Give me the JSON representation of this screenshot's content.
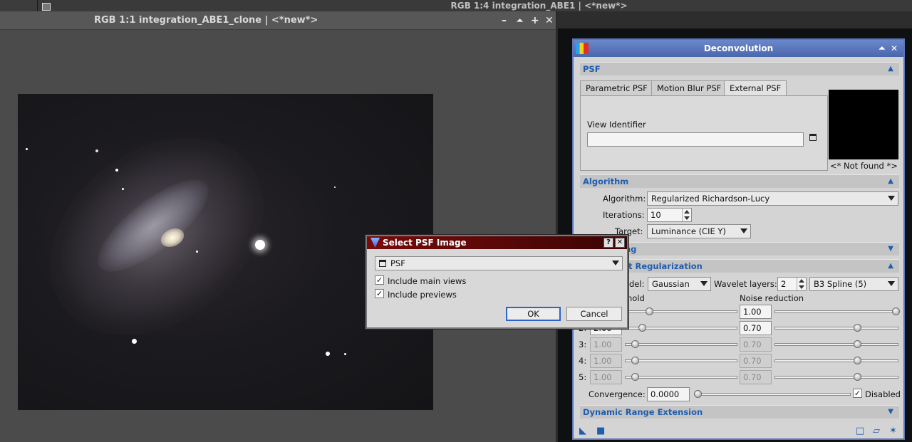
{
  "background_window": {
    "title": "RGB 1:4 integration_ABE1 | <*new*>"
  },
  "image_window": {
    "title": "RGB 1:1 integration_ABE1_clone | <*new*>",
    "controls": {
      "minimize": "–",
      "shade": "⏶",
      "maximize": "+",
      "close": "✕"
    }
  },
  "deconvolution": {
    "title": "Deconvolution",
    "sections": {
      "psf": "PSF",
      "algorithm": "Algorithm",
      "deringing_partial": "ing",
      "wavelet_partial": "t Regularization",
      "dynamic_range": "Dynamic Range Extension"
    },
    "psf_tabs": [
      "Parametric PSF",
      "Motion Blur PSF",
      "External PSF"
    ],
    "view_identifier_label": "View Identifier",
    "view_identifier_value": "",
    "not_found": "<* Not found *>",
    "algorithm": {
      "algorithm_label": "Algorithm:",
      "algorithm_value": "Regularized Richardson-Lucy",
      "iterations_label": "Iterations:",
      "iterations_value": "10",
      "target_label": "Target:",
      "target_value": "Luminance (CIE Y)"
    },
    "wavelet": {
      "noise_model_label": "del:",
      "noise_model_value": "Gaussian",
      "layers_label": "Wavelet layers:",
      "layers_value": "2",
      "scaling_value": "B3 Spline (5)",
      "threshold_header": "shold",
      "noise_reduction_header": "Noise reduction",
      "rows": [
        {
          "index": "",
          "threshold": "",
          "noise": "1.00",
          "enabled": true
        },
        {
          "index": "2:",
          "threshold": "2.00",
          "noise": "0.70",
          "enabled": true
        },
        {
          "index": "3:",
          "threshold": "1.00",
          "noise": "0.70",
          "enabled": false
        },
        {
          "index": "4:",
          "threshold": "1.00",
          "noise": "0.70",
          "enabled": false
        },
        {
          "index": "5:",
          "threshold": "1.00",
          "noise": "0.70",
          "enabled": false
        }
      ],
      "convergence_label": "Convergence:",
      "convergence_value": "0.0000",
      "disabled_label": "Disabled"
    }
  },
  "dialog": {
    "title": "Select PSF Image",
    "help": "?",
    "close": "✕",
    "selected_view": "PSF",
    "include_main_views": "Include main views",
    "include_previews": "Include previews",
    "ok": "OK",
    "cancel": "Cancel"
  },
  "colors": {
    "section_text": "#1f5db0",
    "panel_title": "#4a67ad",
    "dialog_title": "#7a0b0b"
  }
}
